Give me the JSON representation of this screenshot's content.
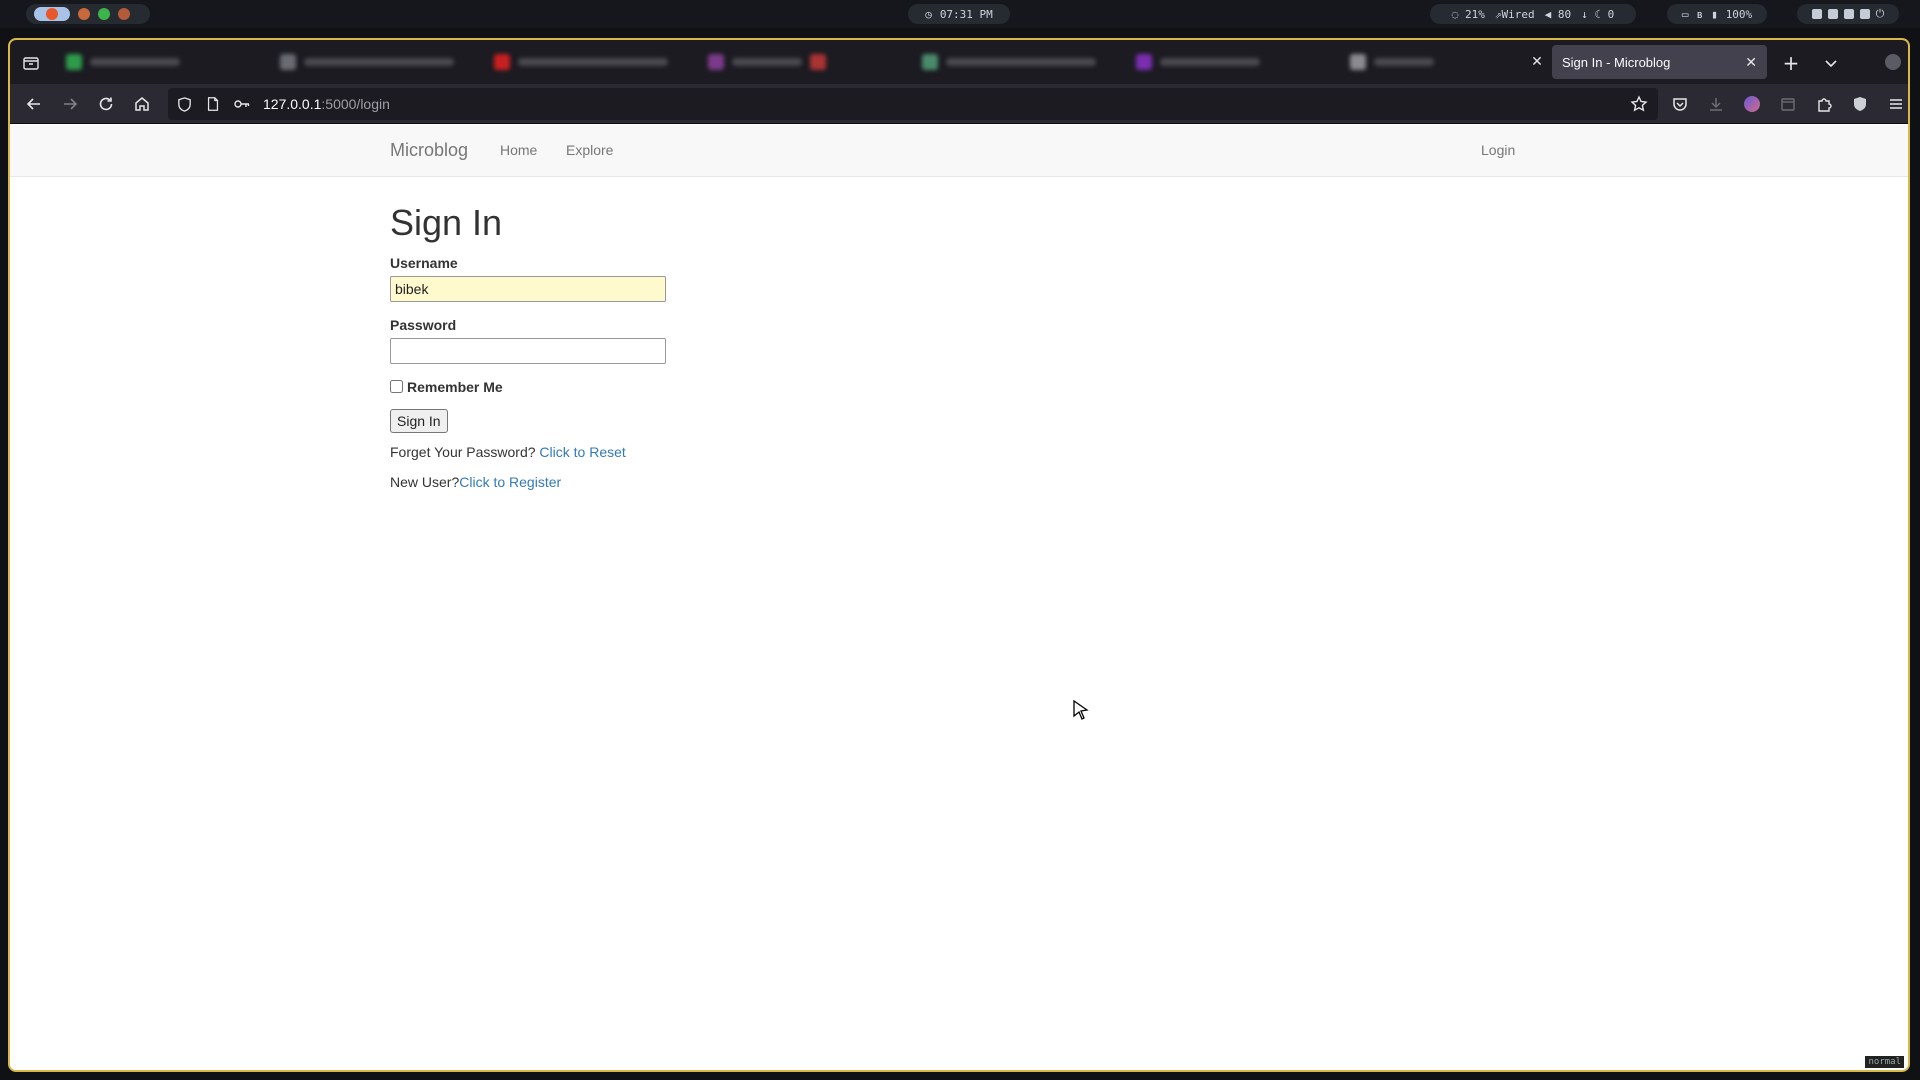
{
  "os_bar": {
    "clock": "07:31 PM",
    "cpu": "21%",
    "network": "Wired",
    "volume": "80",
    "downloads": "0",
    "battery": "100%"
  },
  "browser": {
    "active_tab_title": "Sign In - Microblog",
    "url_host": "127.0.0.1",
    "url_path": ":5000/login"
  },
  "site_nav": {
    "brand": "Microblog",
    "links": [
      "Home",
      "Explore"
    ],
    "login": "Login"
  },
  "login_form": {
    "title": "Sign In",
    "username_label": "Username",
    "username_value": "bibek",
    "password_label": "Password",
    "password_value": "",
    "remember_label": "Remember Me",
    "remember_checked": false,
    "submit_label": "Sign In",
    "forgot_text": "Forget Your Password?",
    "forgot_link": "Click to Reset",
    "new_user_text": "New User?",
    "register_link": "Click to Register"
  },
  "editor_mode": "normal",
  "colors": {
    "window_border": "#d9b84a",
    "link": "#337ab7",
    "autofill": "#fffacd"
  }
}
